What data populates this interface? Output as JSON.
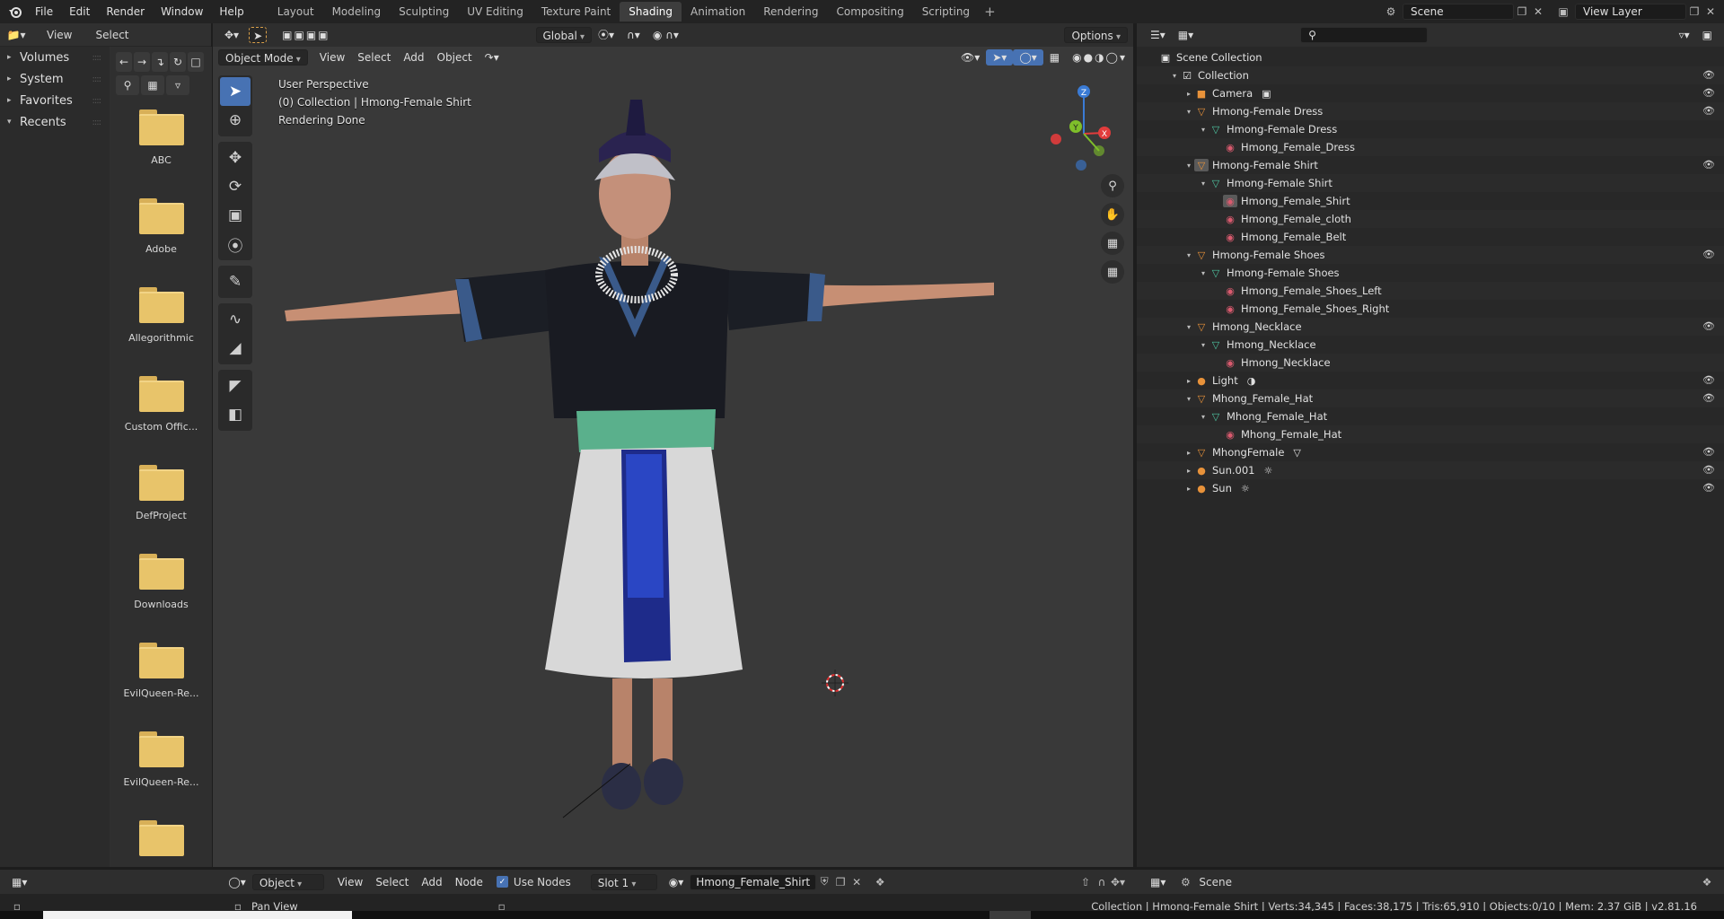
{
  "menu": [
    "File",
    "Edit",
    "Render",
    "Window",
    "Help"
  ],
  "workspaces": [
    {
      "label": "Layout",
      "active": false
    },
    {
      "label": "Modeling",
      "active": false
    },
    {
      "label": "Sculpting",
      "active": false
    },
    {
      "label": "UV Editing",
      "active": false
    },
    {
      "label": "Texture Paint",
      "active": false
    },
    {
      "label": "Shading",
      "active": true
    },
    {
      "label": "Animation",
      "active": false
    },
    {
      "label": "Rendering",
      "active": false
    },
    {
      "label": "Compositing",
      "active": false
    },
    {
      "label": "Scripting",
      "active": false
    }
  ],
  "top_right": {
    "scene": "Scene",
    "view_layer": "View Layer"
  },
  "filebrowser": {
    "header": {
      "view": "View",
      "select": "Select"
    },
    "sections": [
      "Volumes",
      "System",
      "Favorites",
      "Recents"
    ],
    "folders": [
      "ABC",
      "Adobe",
      "Allegorithmic",
      "Custom Offic...",
      "DefProject",
      "Downloads",
      "EvilQueen-Re...",
      "EvilQueen-Re...",
      ""
    ]
  },
  "viewport": {
    "mode": "Object Mode",
    "menus": [
      "View",
      "Select",
      "Add",
      "Object"
    ],
    "orientation": "Global",
    "options": "Options",
    "info": [
      "User Perspective",
      "(0) Collection | Hmong-Female Shirt",
      "Rendering Done"
    ],
    "gizmo": {
      "x": "X",
      "y": "Y",
      "z": "Z"
    }
  },
  "outliner": {
    "root": "Scene Collection",
    "rows": [
      {
        "indent": 1,
        "tri": "▾",
        "icon": "collection",
        "label": "Collection",
        "eye": true,
        "extra": ""
      },
      {
        "indent": 2,
        "tri": "▸",
        "icon": "camera",
        "label": "Camera",
        "eye": true,
        "extra": "camera-data"
      },
      {
        "indent": 2,
        "tri": "▾",
        "icon": "object",
        "label": "Hmong-Female Dress",
        "eye": true,
        "extra": ""
      },
      {
        "indent": 3,
        "tri": "▾",
        "icon": "mesh",
        "label": "Hmong-Female Dress",
        "eye": false,
        "extra": ""
      },
      {
        "indent": 4,
        "tri": "",
        "icon": "material",
        "label": "Hmong_Female_Dress",
        "eye": false,
        "extra": ""
      },
      {
        "indent": 2,
        "tri": "▾",
        "icon": "object-active",
        "label": "Hmong-Female Shirt",
        "eye": true,
        "extra": ""
      },
      {
        "indent": 3,
        "tri": "▾",
        "icon": "mesh",
        "label": "Hmong-Female Shirt",
        "eye": false,
        "extra": ""
      },
      {
        "indent": 4,
        "tri": "",
        "icon": "material-active",
        "label": "Hmong_Female_Shirt",
        "eye": false,
        "extra": ""
      },
      {
        "indent": 4,
        "tri": "",
        "icon": "material",
        "label": "Hmong_Female_cloth",
        "eye": false,
        "extra": ""
      },
      {
        "indent": 4,
        "tri": "",
        "icon": "material",
        "label": "Hmong_Female_Belt",
        "eye": false,
        "extra": ""
      },
      {
        "indent": 2,
        "tri": "▾",
        "icon": "object",
        "label": "Hmong-Female Shoes",
        "eye": true,
        "extra": ""
      },
      {
        "indent": 3,
        "tri": "▾",
        "icon": "mesh",
        "label": "Hmong-Female Shoes",
        "eye": false,
        "extra": ""
      },
      {
        "indent": 4,
        "tri": "",
        "icon": "material",
        "label": "Hmong_Female_Shoes_Left",
        "eye": false,
        "extra": ""
      },
      {
        "indent": 4,
        "tri": "",
        "icon": "material",
        "label": "Hmong_Female_Shoes_Right",
        "eye": false,
        "extra": ""
      },
      {
        "indent": 2,
        "tri": "▾",
        "icon": "object",
        "label": "Hmong_Necklace",
        "eye": true,
        "extra": ""
      },
      {
        "indent": 3,
        "tri": "▾",
        "icon": "mesh",
        "label": "Hmong_Necklace",
        "eye": false,
        "extra": ""
      },
      {
        "indent": 4,
        "tri": "",
        "icon": "material",
        "label": "Hmong_Necklace",
        "eye": false,
        "extra": ""
      },
      {
        "indent": 2,
        "tri": "▸",
        "icon": "light",
        "label": "Light",
        "eye": true,
        "extra": "light-data"
      },
      {
        "indent": 2,
        "tri": "▾",
        "icon": "object",
        "label": "Mhong_Female_Hat",
        "eye": true,
        "extra": ""
      },
      {
        "indent": 3,
        "tri": "▾",
        "icon": "mesh",
        "label": "Mhong_Female_Hat",
        "eye": false,
        "extra": ""
      },
      {
        "indent": 4,
        "tri": "",
        "icon": "material",
        "label": "Mhong_Female_Hat",
        "eye": false,
        "extra": ""
      },
      {
        "indent": 2,
        "tri": "▸",
        "icon": "object",
        "label": "MhongFemale",
        "eye": true,
        "extra": "mesh-data"
      },
      {
        "indent": 2,
        "tri": "▸",
        "icon": "light",
        "label": "Sun.001",
        "eye": true,
        "extra": "sun-data"
      },
      {
        "indent": 2,
        "tri": "▸",
        "icon": "light",
        "label": "Sun",
        "eye": true,
        "extra": "sun-data"
      }
    ]
  },
  "node_header": {
    "mode": "Object",
    "menus": [
      "View",
      "Select",
      "Add",
      "Node"
    ],
    "use_nodes": "Use Nodes",
    "slot": "Slot 1",
    "material": "Hmong_Female_Shirt"
  },
  "props_header": {
    "scene": "Scene"
  },
  "statusbar": {
    "hint": "Pan View",
    "info": "Collection | Hmong-Female Shirt | Verts:34,345 | Faces:38,175 | Tris:65,910 | Objects:0/10 | Mem: 2.37 GiB | v2.81.16"
  },
  "colors": {
    "accent": "#4772b3",
    "object": "#e8923a",
    "mesh": "#4fc7a3",
    "material": "#d85a6e"
  }
}
